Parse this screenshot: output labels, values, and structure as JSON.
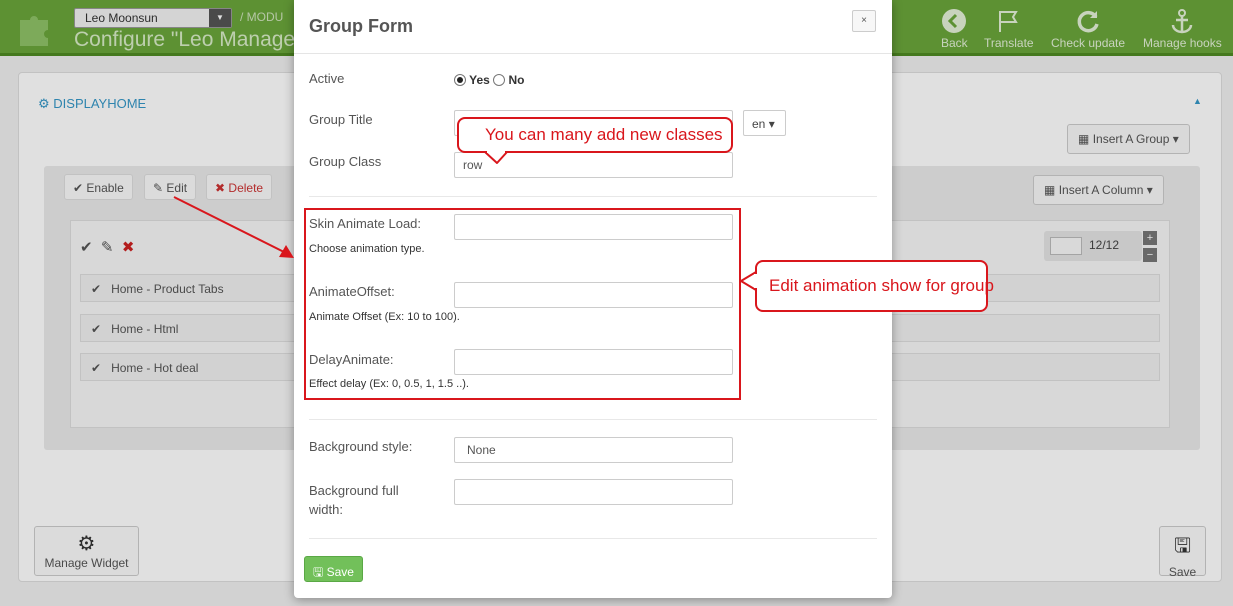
{
  "header": {
    "shop_select": "Leo Moonsun",
    "breadcrumb": "/ MODU",
    "page_title": "Configure \"Leo Manage W",
    "toolbar": [
      {
        "label": "Back",
        "icon": "back-arrow-icon"
      },
      {
        "label": "Translate",
        "icon": "flag-icon"
      },
      {
        "label": "Check update",
        "icon": "refresh-icon"
      },
      {
        "label": "Manage hooks",
        "icon": "anchor-icon"
      }
    ]
  },
  "background": {
    "section_title": "DISPLAYHOME",
    "actions": {
      "enable": "Enable",
      "edit": "Edit",
      "delete": "Delete"
    },
    "insert_group": "Insert A Group",
    "insert_column": "Insert A Column",
    "column_size": "12/12",
    "widgets": [
      "Home - Product Tabs",
      "Home - Html",
      "Home - Hot deal"
    ],
    "manage_widget": "Manage Widget",
    "save": "Save"
  },
  "modal": {
    "title": "Group Form",
    "close": "×",
    "active_label": "Active",
    "active_yes": "Yes",
    "active_no": "No",
    "group_title_label": "Group Title",
    "group_title_value": "",
    "lang": "en",
    "group_class_label": "Group Class",
    "group_class_value": "row",
    "skin_animate_label": "Skin Animate Load:",
    "skin_animate_help": "Choose animation type.",
    "animate_offset_label": "AnimateOffset:",
    "animate_offset_help": "Animate Offset (Ex: 10 to 100).",
    "delay_animate_label": "DelayAnimate:",
    "delay_animate_help": "Effect delay (Ex: 0, 0.5, 1, 1.5 ..).",
    "background_style_label": "Background style:",
    "background_style_value": "None",
    "background_full_label_1": "Background full",
    "background_full_label_2": "width:",
    "save": "Save"
  },
  "annotations": {
    "callout_classes": "You can many add new classes",
    "callout_animation": "Edit animation show for group"
  },
  "colors": {
    "header_green": "#6aa53b",
    "link_blue": "#3597c7",
    "annotation_red": "#d9161c",
    "save_green": "#72c05a"
  }
}
